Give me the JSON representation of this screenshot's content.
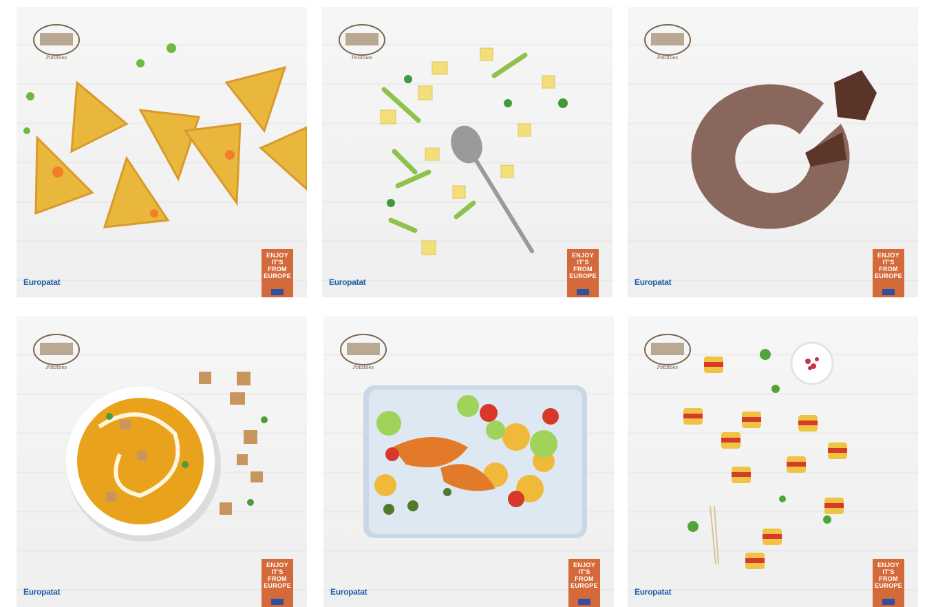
{
  "grid": {
    "tiles": [
      {
        "subject": "pie-wedges"
      },
      {
        "subject": "salad-spoon"
      },
      {
        "subject": "chocolate-cake"
      },
      {
        "subject": "pumpkin-soup"
      },
      {
        "subject": "potato-salad-platter"
      },
      {
        "subject": "potato-skewers"
      }
    ]
  },
  "branding": {
    "seal_text": "Potatoes",
    "brand": "Europatat",
    "badge_lines": [
      "ENJOY",
      "IT'S FROM",
      "EUROPE"
    ]
  },
  "colors": {
    "badge": "#d4693a",
    "brand": "#1f5fa8",
    "background": "#f3f3f3"
  }
}
